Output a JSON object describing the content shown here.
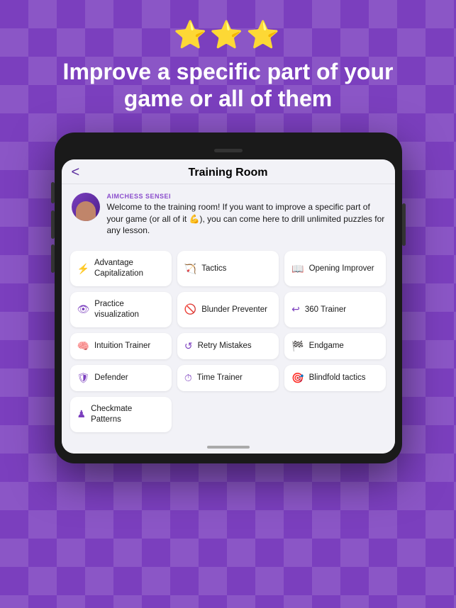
{
  "background": {
    "color": "#7B3FBE"
  },
  "stars": "⭐⭐⭐",
  "headline": "Improve a specific part of your game or all of them",
  "tablet": {
    "nav": {
      "back_label": "<",
      "title": "Training Room"
    },
    "sensei": {
      "label": "AIMCHESS SENSEI",
      "message": "Welcome to the training room! If you want to improve a specific part of your game (or all of it 💪), you can come here to drill unlimited puzzles for any lesson."
    },
    "training_items": [
      {
        "icon": "⚡",
        "label": "Advantage Capitalization"
      },
      {
        "icon": "🏹",
        "label": "Tactics"
      },
      {
        "icon": "📖",
        "label": "Opening Improver"
      },
      {
        "icon": "👁",
        "label": "Practice visualization"
      },
      {
        "icon": "🚫",
        "label": "Blunder Preventer"
      },
      {
        "icon": "↩",
        "label": "360 Trainer"
      },
      {
        "icon": "🧠",
        "label": "Intuition Trainer"
      },
      {
        "icon": "↺",
        "label": "Retry Mistakes"
      },
      {
        "icon": "🏁",
        "label": "Endgame"
      },
      {
        "icon": "🛡",
        "label": "Defender"
      },
      {
        "icon": "⏱",
        "label": "Time Trainer"
      },
      {
        "icon": "🎯",
        "label": "Blindfold tactics"
      },
      {
        "icon": "♟",
        "label": "Checkmate Patterns"
      }
    ]
  }
}
